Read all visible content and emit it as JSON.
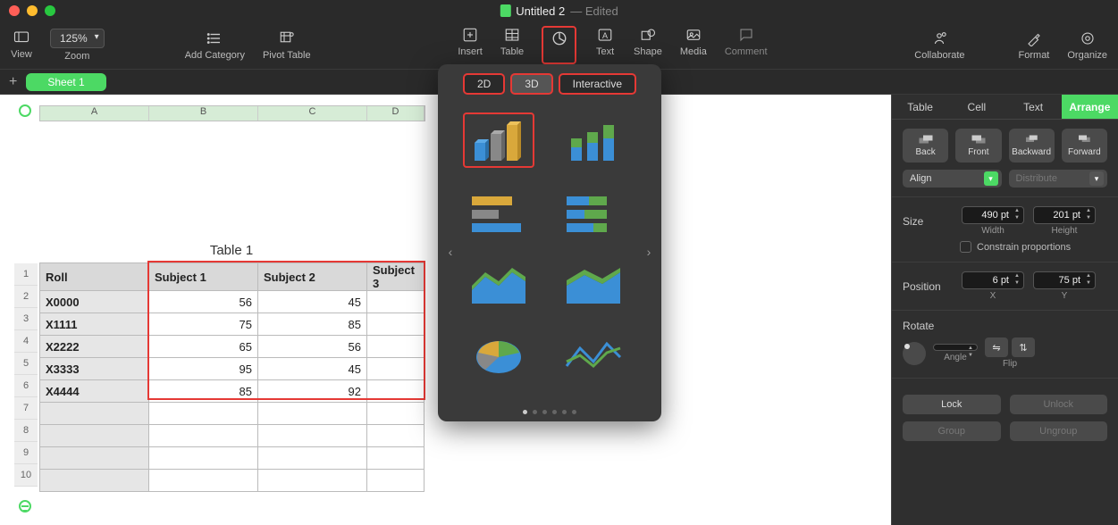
{
  "window": {
    "title": "Untitled 2",
    "edited": "— Edited"
  },
  "toolbar": {
    "view": "View",
    "zoom": "Zoom",
    "zoom_value": "125%",
    "add_category": "Add Category",
    "pivot_table": "Pivot Table",
    "insert": "Insert",
    "table": "Table",
    "chart": "Chart",
    "text": "Text",
    "shape": "Shape",
    "media": "Media",
    "comment": "Comment",
    "collaborate": "Collaborate",
    "format": "Format",
    "organize": "Organize"
  },
  "sheet": {
    "name": "Sheet 1"
  },
  "col_headers": [
    "A",
    "B",
    "C",
    "D"
  ],
  "row_headers": [
    "1",
    "2",
    "3",
    "4",
    "5",
    "6",
    "7",
    "8",
    "9",
    "10"
  ],
  "table": {
    "title": "Table 1",
    "headers": [
      "Roll",
      "Subject 1",
      "Subject 2",
      "Subject 3"
    ],
    "rows": [
      {
        "key": "X0000",
        "s1": "56",
        "s2": "45",
        "s3": ""
      },
      {
        "key": "X1111",
        "s1": "75",
        "s2": "85",
        "s3": ""
      },
      {
        "key": "X2222",
        "s1": "65",
        "s2": "56",
        "s3": ""
      },
      {
        "key": "X3333",
        "s1": "95",
        "s2": "45",
        "s3": ""
      },
      {
        "key": "X4444",
        "s1": "85",
        "s2": "92",
        "s3": ""
      }
    ]
  },
  "popover": {
    "tab_2d": "2D",
    "tab_3d": "3D",
    "tab_interactive": "Interactive"
  },
  "inspector": {
    "tabs": {
      "table": "Table",
      "cell": "Cell",
      "text": "Text",
      "arrange": "Arrange"
    },
    "back": "Back",
    "front": "Front",
    "backward": "Backward",
    "forward": "Forward",
    "align": "Align",
    "distribute": "Distribute",
    "size": "Size",
    "width_val": "490 pt",
    "width_lbl": "Width",
    "height_val": "201 pt",
    "height_lbl": "Height",
    "constrain": "Constrain proportions",
    "position": "Position",
    "x_val": "6 pt",
    "x_lbl": "X",
    "y_val": "75 pt",
    "y_lbl": "Y",
    "rotate": "Rotate",
    "angle_lbl": "Angle",
    "flip_lbl": "Flip",
    "lock": "Lock",
    "unlock": "Unlock",
    "group": "Group",
    "ungroup": "Ungroup"
  }
}
